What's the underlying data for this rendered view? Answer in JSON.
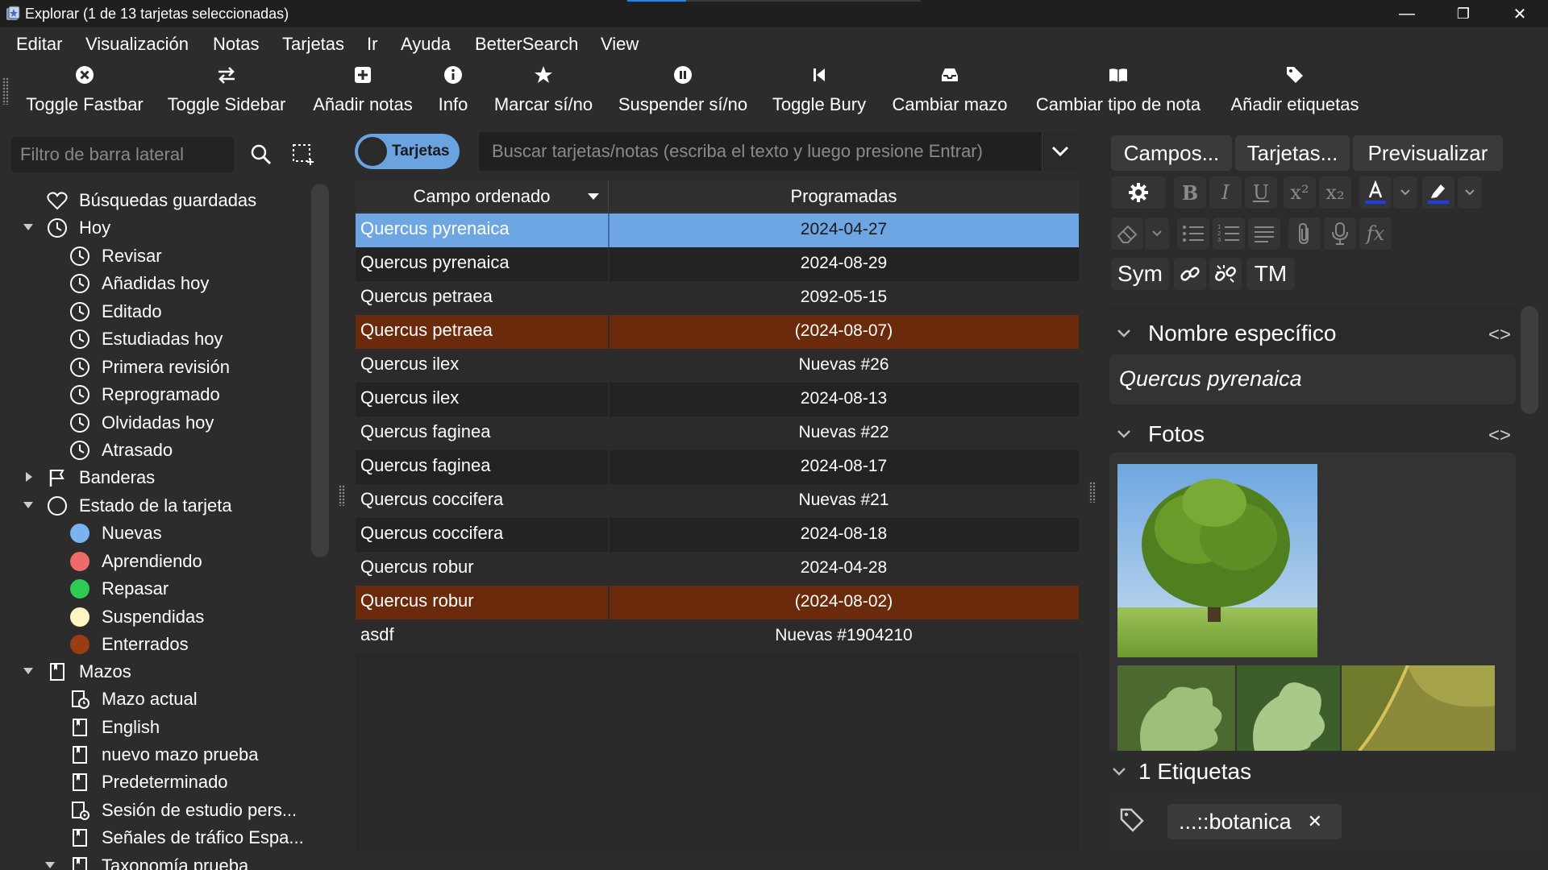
{
  "window": {
    "title": "Explorar (1 de 13 tarjetas seleccionadas)",
    "minimize": "—",
    "restore": "❐",
    "close": "✕",
    "progress": 0.2
  },
  "menu": [
    "Editar",
    "Visualización",
    "Notas",
    "Tarjetas",
    "Ir",
    "Ayuda",
    "BetterSearch",
    "View"
  ],
  "toolbar": {
    "toggle_fastbar": "Toggle Fastbar",
    "toggle_sidebar": "Toggle Sidebar",
    "add_notes": "Añadir notas",
    "info": "Info",
    "mark": "Marcar sí/no",
    "suspend": "Suspender sí/no",
    "bury": "Toggle Bury",
    "change_deck": "Cambiar mazo",
    "change_notetype": "Cambiar tipo de nota",
    "add_tags": "Añadir etiquetas"
  },
  "sidebar": {
    "filter_placeholder": "Filtro de barra lateral",
    "saved_searches": "Búsquedas guardadas",
    "today": "Hoy",
    "today_items": [
      "Revisar",
      "Añadidas hoy",
      "Editado",
      "Estudiadas hoy",
      "Primera revisión",
      "Reprogramado",
      "Olvidadas hoy",
      "Atrasado"
    ],
    "flags": "Banderas",
    "card_state": "Estado de la tarjeta",
    "states": [
      {
        "label": "Nuevas",
        "color": "#7ab4ee"
      },
      {
        "label": "Aprendiendo",
        "color": "#f06a6a"
      },
      {
        "label": "Repasar",
        "color": "#2ecc55"
      },
      {
        "label": "Suspendidas",
        "color": "#fff6c4"
      },
      {
        "label": "Enterrados",
        "color": "#9a3d10"
      }
    ],
    "decks": "Mazos",
    "deck_items": [
      "Mazo actual",
      "English",
      "nuevo mazo prueba",
      "Predeterminado",
      "Sesión de estudio pers...",
      "Señales de tráfico Espa...",
      "Taxonomía prueba"
    ]
  },
  "search": {
    "mode_label": "Tarjetas",
    "placeholder": "Buscar tarjetas/notas (escriba el texto y luego presione Entrar)"
  },
  "table": {
    "col1": "Campo ordenado",
    "col2": "Programadas",
    "rows": [
      {
        "sort": "Quercus pyrenaica",
        "due": "2024-04-27",
        "state": "selected"
      },
      {
        "sort": "Quercus pyrenaica",
        "due": "2024-08-29",
        "state": "normal"
      },
      {
        "sort": "Quercus petraea",
        "due": "2092-05-15",
        "state": "normal"
      },
      {
        "sort": "Quercus petraea",
        "due": "(2024-08-07)",
        "state": "buried"
      },
      {
        "sort": "Quercus ilex",
        "due": "Nuevas #26",
        "state": "normal"
      },
      {
        "sort": "Quercus ilex",
        "due": "2024-08-13",
        "state": "normal"
      },
      {
        "sort": "Quercus faginea",
        "due": "Nuevas #22",
        "state": "normal"
      },
      {
        "sort": "Quercus faginea",
        "due": "2024-08-17",
        "state": "normal"
      },
      {
        "sort": "Quercus coccifera",
        "due": "Nuevas #21",
        "state": "normal"
      },
      {
        "sort": "Quercus coccifera",
        "due": "2024-08-18",
        "state": "normal"
      },
      {
        "sort": "Quercus robur",
        "due": "2024-04-28",
        "state": "normal"
      },
      {
        "sort": "Quercus robur",
        "due": "(2024-08-02)",
        "state": "buried"
      },
      {
        "sort": "asdf",
        "due": "Nuevas #1904210",
        "state": "normal"
      }
    ]
  },
  "editor": {
    "fields_btn": "Campos...",
    "cards_btn": "Tarjetas...",
    "preview_btn": "Previsualizar",
    "sym": "Sym",
    "tm": "TM",
    "field1_name": "Nombre específico",
    "field1_value": "Quercus pyrenaica",
    "field2_name": "Fotos",
    "tags_header": "1 Etiquetas",
    "tag": "...::botanica",
    "tag_remove": "✕"
  },
  "colors": {
    "selected_row": "#6ea5e3",
    "buried_row": "#6b2a0c",
    "row_dark": "#232323",
    "row_light": "#2b2b2b",
    "accent_blue": "#1e88e5"
  }
}
